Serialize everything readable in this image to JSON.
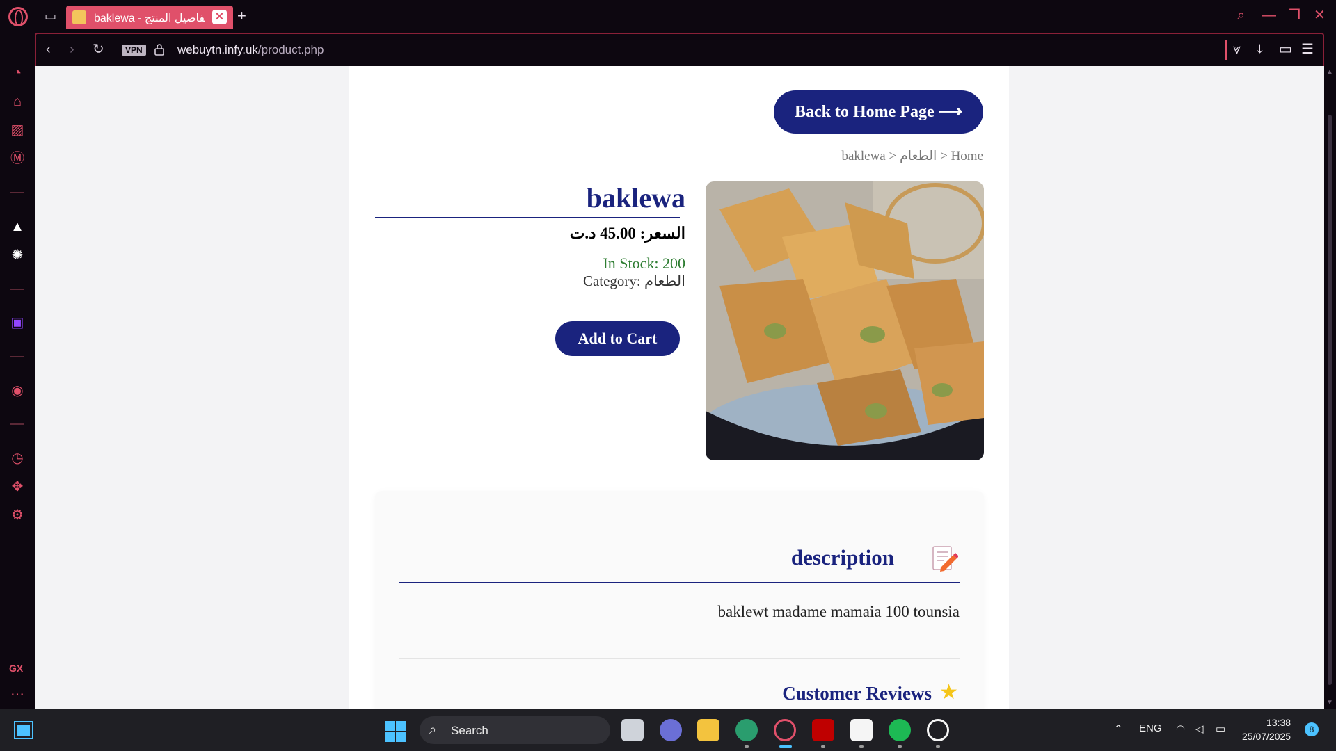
{
  "browser": {
    "tab_title": "baklewa - تفاصيل المنتج",
    "url_domain": "webuytn.infy.uk",
    "url_path": "/product.php",
    "vpn_label": "VPN",
    "sidebar_label": "GX"
  },
  "page": {
    "back_button": "Back to Home Page ⟶",
    "breadcrumb": "Home < الطعام < baklewa",
    "product": {
      "title": "baklewa",
      "price": "السعر: 45.00 د.ت",
      "stock": "In Stock: 200",
      "category": "Category: الطعام",
      "add_to_cart": "Add to Cart"
    },
    "description": {
      "heading": "description",
      "text": "baklewt madame mamaia 100 tounsia"
    },
    "reviews": {
      "heading": "Customer Reviews"
    }
  },
  "taskbar": {
    "search_label": "Search",
    "language": "ENG",
    "time": "13:38",
    "date": "25/07/2025",
    "notification_count": "8"
  },
  "colors": {
    "accent": "#1a237e",
    "browser_accent": "#e0506a",
    "stock_green": "#2e7d32"
  }
}
